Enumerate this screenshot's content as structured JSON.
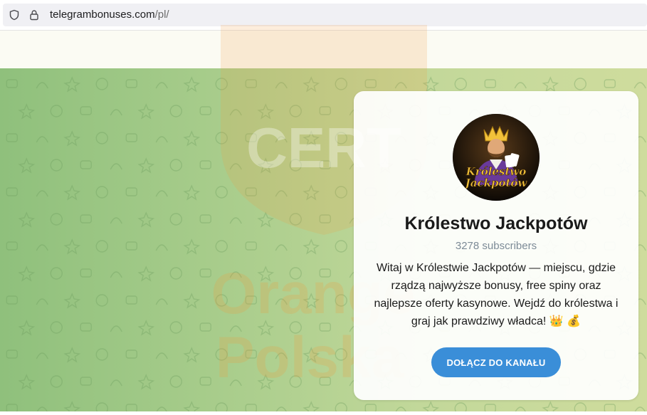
{
  "browser": {
    "url_host": "telegrambonuses.com",
    "url_path": "/pl/",
    "icons": [
      "shield-icon",
      "lock-icon"
    ]
  },
  "watermark": {
    "line1": "CERT",
    "line2": "Orange",
    "line3": "Polska",
    "color": "#f39c3c"
  },
  "channel": {
    "avatar_text_line1": "Królestwo",
    "avatar_text_line2": "Jackpotów",
    "title": "Królestwo Jackpotów",
    "subscribers": "3278 subscribers",
    "description": "Witaj w Królestwie Jackpotów — miejscu, gdzie rządzą najwyższe bonusy, free spiny oraz najlepsze oferty kasynowe. Wejdź do królestwa i graj jak prawdziwy władca! 👑 💰",
    "join_label": "DOŁĄCZ DO KANAŁU"
  },
  "colors": {
    "accent": "#3a8ed8",
    "background_green": "#a9cd8c"
  }
}
